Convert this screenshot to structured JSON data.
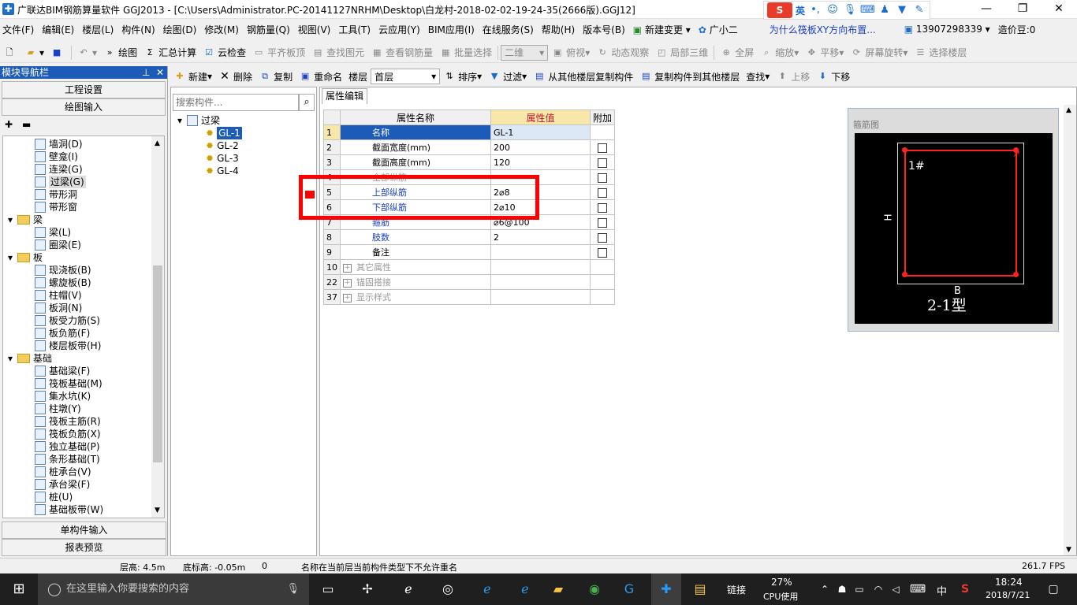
{
  "window": {
    "title": "广联达BIM钢筋算量软件 GGJ2013 - [C:\\Users\\Administrator.PC-20141127NRHM\\Desktop\\白龙村-2018-02-02-19-24-35(2666版).GGJ12]",
    "min": "—",
    "max": "❐",
    "close": "✕"
  },
  "ime": {
    "label": "英"
  },
  "menubar": {
    "items": [
      "文件(F)",
      "编辑(E)",
      "楼层(L)",
      "构件(N)",
      "绘图(D)",
      "修改(M)",
      "钢筋量(Q)",
      "视图(V)",
      "工具(T)",
      "云应用(Y)",
      "BIM应用(I)",
      "在线服务(S)",
      "帮助(H)",
      "版本号(B)",
      "新建变更 ▾",
      "广小二"
    ],
    "tip": "为什么筏板XY方向布置...",
    "phone": "13907298339 ▾",
    "beans": "造价豆:0"
  },
  "toolbar1": {
    "draw": "绘图",
    "sum": "汇总计算",
    "cloudcheck": "云检查",
    "flatboard": "平齐板顶",
    "findelem": "查找图元",
    "viewrebar": "查看钢筋量",
    "batchsel": "批量选择",
    "view2d": "二维",
    "top": "俯视",
    "dynamic": "动态观察",
    "local3d": "局部三维",
    "fullscreen": "全屏",
    "zoom": "缩放",
    "pan": "平移",
    "rotate": "屏幕旋转",
    "selfloor": "选择楼层"
  },
  "toolbar2": {
    "new": "新建",
    "delete": "删除",
    "copy": "复制",
    "rename": "重命名",
    "floor_label": "楼层",
    "floor_value": "首层",
    "sort": "排序",
    "filter": "过滤",
    "copyfrom": "从其他楼层复制构件",
    "copyto": "复制构件到其他楼层",
    "find": "查找",
    "up": "上移",
    "down": "下移"
  },
  "nav": {
    "title": "模块导航栏",
    "project": "工程设置",
    "drawing": "绘图输入",
    "single": "单构件输入",
    "report": "报表预览",
    "tree": [
      {
        "label": "墙洞(D)",
        "level": 2
      },
      {
        "label": "壁龛(I)",
        "level": 2
      },
      {
        "label": "连梁(G)",
        "level": 2
      },
      {
        "label": "过梁(G)",
        "level": 2,
        "selected": true
      },
      {
        "label": "带形洞",
        "level": 2
      },
      {
        "label": "带形窗",
        "level": 2
      },
      {
        "label": "梁",
        "level": 1
      },
      {
        "label": "梁(L)",
        "level": 2
      },
      {
        "label": "圈梁(E)",
        "level": 2
      },
      {
        "label": "板",
        "level": 1
      },
      {
        "label": "现浇板(B)",
        "level": 2
      },
      {
        "label": "螺旋板(B)",
        "level": 2
      },
      {
        "label": "柱帽(V)",
        "level": 2
      },
      {
        "label": "板洞(N)",
        "level": 2
      },
      {
        "label": "板受力筋(S)",
        "level": 2
      },
      {
        "label": "板负筋(F)",
        "level": 2
      },
      {
        "label": "楼层板带(H)",
        "level": 2
      },
      {
        "label": "基础",
        "level": 1
      },
      {
        "label": "基础梁(F)",
        "level": 2
      },
      {
        "label": "筏板基础(M)",
        "level": 2
      },
      {
        "label": "集水坑(K)",
        "level": 2
      },
      {
        "label": "柱墩(Y)",
        "level": 2
      },
      {
        "label": "筏板主筋(R)",
        "level": 2
      },
      {
        "label": "筏板负筋(X)",
        "level": 2
      },
      {
        "label": "独立基础(P)",
        "level": 2
      },
      {
        "label": "条形基础(T)",
        "level": 2
      },
      {
        "label": "桩承台(V)",
        "level": 2
      },
      {
        "label": "承台梁(F)",
        "level": 2
      },
      {
        "label": "桩(U)",
        "level": 2
      },
      {
        "label": "基础板带(W)",
        "level": 2
      }
    ]
  },
  "components": {
    "search_placeholder": "搜索构件...",
    "root": "过梁",
    "items": [
      "GL-1",
      "GL-2",
      "GL-3",
      "GL-4"
    ]
  },
  "props": {
    "tab": "属性编辑",
    "col_name": "属性名称",
    "col_value": "属性值",
    "col_extra": "附加",
    "rows": [
      {
        "n": "1",
        "name": "名称",
        "value": "GL-1",
        "check": false,
        "style": "sel"
      },
      {
        "n": "2",
        "name": "截面宽度(mm)",
        "value": "200",
        "check": true,
        "style": ""
      },
      {
        "n": "3",
        "name": "截面高度(mm)",
        "value": "120",
        "check": true,
        "style": ""
      },
      {
        "n": "4",
        "name": "全部纵筋",
        "value": "",
        "check": true,
        "style": "gray"
      },
      {
        "n": "5",
        "name": "上部纵筋",
        "value": "2⌀8",
        "check": true,
        "style": "blue"
      },
      {
        "n": "6",
        "name": "下部纵筋",
        "value": "2⌀10",
        "check": true,
        "style": "blue"
      },
      {
        "n": "7",
        "name": "箍筋",
        "value": "⌀6@100",
        "check": true,
        "style": "blue"
      },
      {
        "n": "8",
        "name": "肢数",
        "value": "2",
        "check": true,
        "style": "blue"
      },
      {
        "n": "9",
        "name": "备注",
        "value": "",
        "check": true,
        "style": ""
      },
      {
        "n": "10",
        "name": "其它属性",
        "value": "",
        "check": false,
        "style": "grp"
      },
      {
        "n": "22",
        "name": "锚固搭接",
        "value": "",
        "check": false,
        "style": "grp"
      },
      {
        "n": "37",
        "name": "显示样式",
        "value": "",
        "check": false,
        "style": "grp"
      }
    ]
  },
  "preview": {
    "title": "箍筋图",
    "bar_label": "1#",
    "h_label": "H",
    "b_label": "B",
    "type_label": "2-1型",
    "bg": "#000000",
    "rebar": "#ff0000"
  },
  "status": {
    "floor_h": "层高: 4.5m",
    "base_h": "底标高: -0.05m",
    "zero": "0",
    "msg": "名称在当前层当前构件类型下不允许重名",
    "fps": "261.7 FPS"
  },
  "taskbar": {
    "search": "在这里输入你要搜索的内容",
    "link": "链接",
    "cpu_pct": "27%",
    "cpu_label": "CPU使用",
    "lang": "中",
    "time": "18:24",
    "date": "2018/7/21"
  },
  "colors": {
    "accent": "#1c5cb8",
    "highlight": "#ff0000"
  }
}
